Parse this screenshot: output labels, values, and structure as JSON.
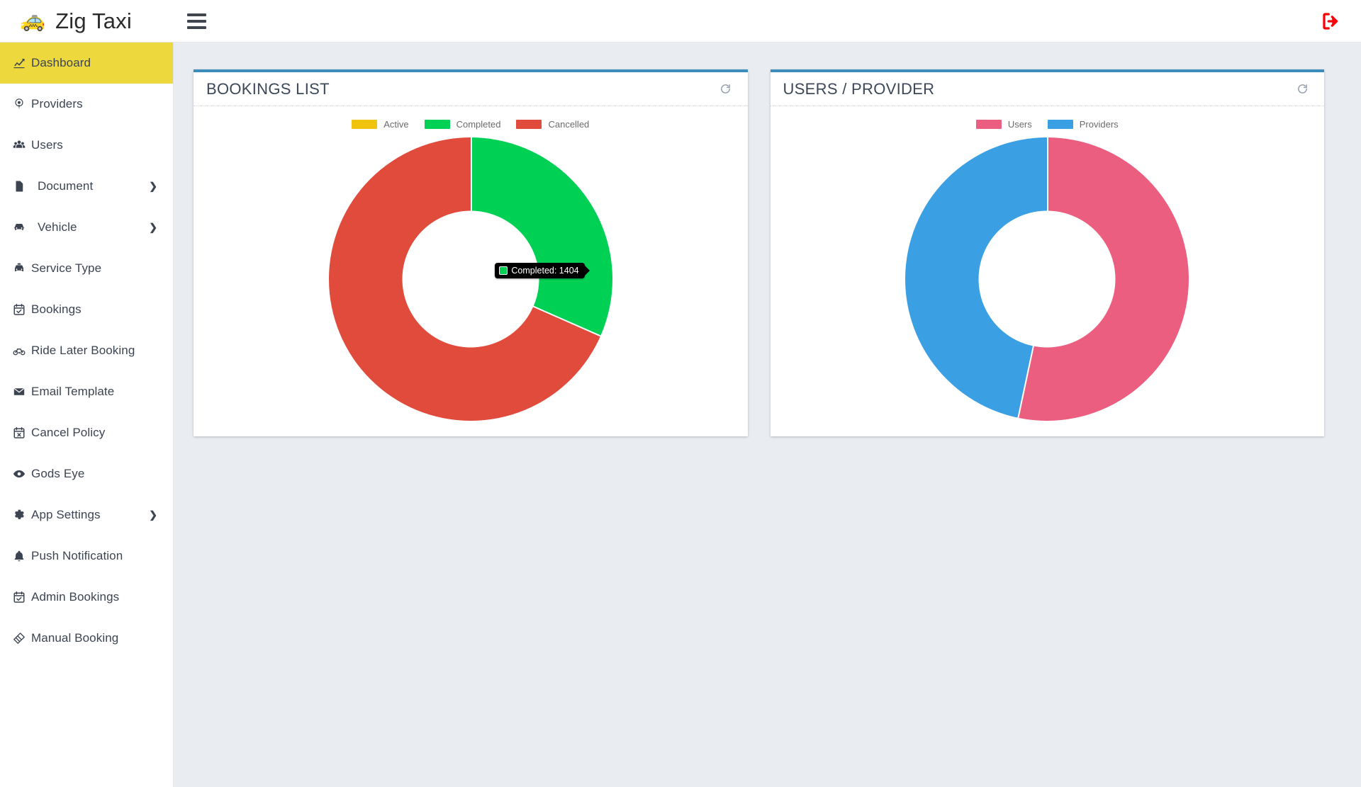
{
  "app": {
    "brand_name": "Zig Taxi",
    "brand_logo_icon": "taxi-car-icon",
    "menu_toggle_icon": "hamburger-icon",
    "logout_icon": "logout-arrow-icon",
    "accent_yellow": "#edd93e",
    "card_accent": "#3c8dbc",
    "page_background": "#e9ecf1"
  },
  "sidebar": {
    "items": [
      {
        "label": "Dashboard",
        "icon": "chart-line-icon",
        "active": true,
        "caret": false,
        "indent": false
      },
      {
        "label": "Providers",
        "icon": "map-marker-icon",
        "active": false,
        "caret": false,
        "indent": false
      },
      {
        "label": "Users",
        "icon": "users-group-icon",
        "active": false,
        "caret": false,
        "indent": false
      },
      {
        "label": "Document",
        "icon": "file-icon",
        "active": false,
        "caret": true,
        "indent": true
      },
      {
        "label": "Vehicle",
        "icon": "car-icon",
        "active": false,
        "caret": true,
        "indent": true
      },
      {
        "label": "Service Type",
        "icon": "taxi-icon",
        "active": false,
        "caret": false,
        "indent": false
      },
      {
        "label": "Bookings",
        "icon": "calendar-check-icon",
        "active": false,
        "caret": false,
        "indent": false
      },
      {
        "label": "Ride Later Booking",
        "icon": "bicycle-icon",
        "active": false,
        "caret": false,
        "indent": false
      },
      {
        "label": "Email Template",
        "icon": "envelope-icon",
        "active": false,
        "caret": false,
        "indent": false
      },
      {
        "label": "Cancel Policy",
        "icon": "calendar-x-icon",
        "active": false,
        "caret": false,
        "indent": false
      },
      {
        "label": "Gods Eye",
        "icon": "eye-icon",
        "active": false,
        "caret": false,
        "indent": false
      },
      {
        "label": "App Settings",
        "icon": "gear-icon",
        "active": false,
        "caret": true,
        "indent": false
      },
      {
        "label": "Push Notification",
        "icon": "bell-icon",
        "active": false,
        "caret": false,
        "indent": false
      },
      {
        "label": "Admin Bookings",
        "icon": "calendar-check-icon",
        "active": false,
        "caret": false,
        "indent": false
      },
      {
        "label": "Manual Booking",
        "icon": "ticket-icon",
        "active": false,
        "caret": false,
        "indent": false
      }
    ]
  },
  "cards": [
    {
      "title": "BOOKINGS LIST",
      "refresh_icon": "refresh-icon",
      "tooltip": {
        "label": "Completed",
        "value": 1404,
        "text": "Completed: 1404",
        "color": "#00d154"
      }
    },
    {
      "title": "USERS / PROVIDER",
      "refresh_icon": "refresh-icon",
      "tooltip": null
    }
  ],
  "chart_data": [
    {
      "type": "pie",
      "title": "BOOKINGS LIST",
      "variant": "donut",
      "categories": [
        "Active",
        "Completed",
        "Cancelled"
      ],
      "values": [
        0,
        1404,
        3035
      ],
      "percentages": [
        0,
        31.6,
        68.4
      ],
      "colors": [
        "#f0c30f",
        "#00d154",
        "#e04b3c"
      ],
      "legend_position": "top",
      "legend": [
        "Active",
        "Completed",
        "Cancelled"
      ],
      "annotations": [
        "Completed: 1404"
      ],
      "start_angle_deg": 0,
      "slice_angles_deg": [
        0,
        113.8,
        246.2
      ]
    },
    {
      "type": "pie",
      "title": "USERS / PROVIDER",
      "variant": "donut",
      "categories": [
        "Users",
        "Providers"
      ],
      "percentages": [
        53.3,
        46.7
      ],
      "colors": [
        "#ec5e7f",
        "#3aa0e3"
      ],
      "legend_position": "top",
      "legend": [
        "Users",
        "Providers"
      ],
      "annotations": [],
      "start_angle_deg": 0,
      "slice_angles_deg": [
        192,
        168
      ]
    }
  ]
}
